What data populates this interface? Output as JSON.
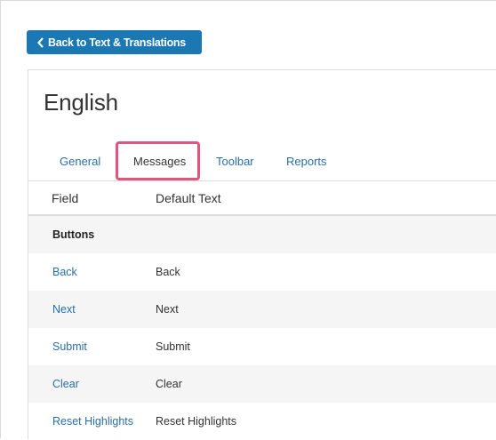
{
  "back_button": {
    "label": "Back to Text & Translations"
  },
  "page_title": "English",
  "tabs": [
    {
      "label": "General",
      "active": false
    },
    {
      "label": "Messages",
      "active": true
    },
    {
      "label": "Toolbar",
      "active": false
    },
    {
      "label": "Reports",
      "active": false
    }
  ],
  "table": {
    "headers": [
      "Field",
      "Default Text"
    ],
    "group_label": "Buttons",
    "rows": [
      {
        "field": "Back",
        "default_text": "Back"
      },
      {
        "field": "Next",
        "default_text": "Next"
      },
      {
        "field": "Submit",
        "default_text": "Submit"
      },
      {
        "field": "Clear",
        "default_text": "Clear"
      },
      {
        "field": "Reset Highlights",
        "default_text": "Reset Highlights"
      }
    ]
  },
  "colors": {
    "accent": "#1b78b2",
    "link": "#2a6ea8",
    "highlight": "#e0557f",
    "row_alt": "#f5f5f5"
  }
}
